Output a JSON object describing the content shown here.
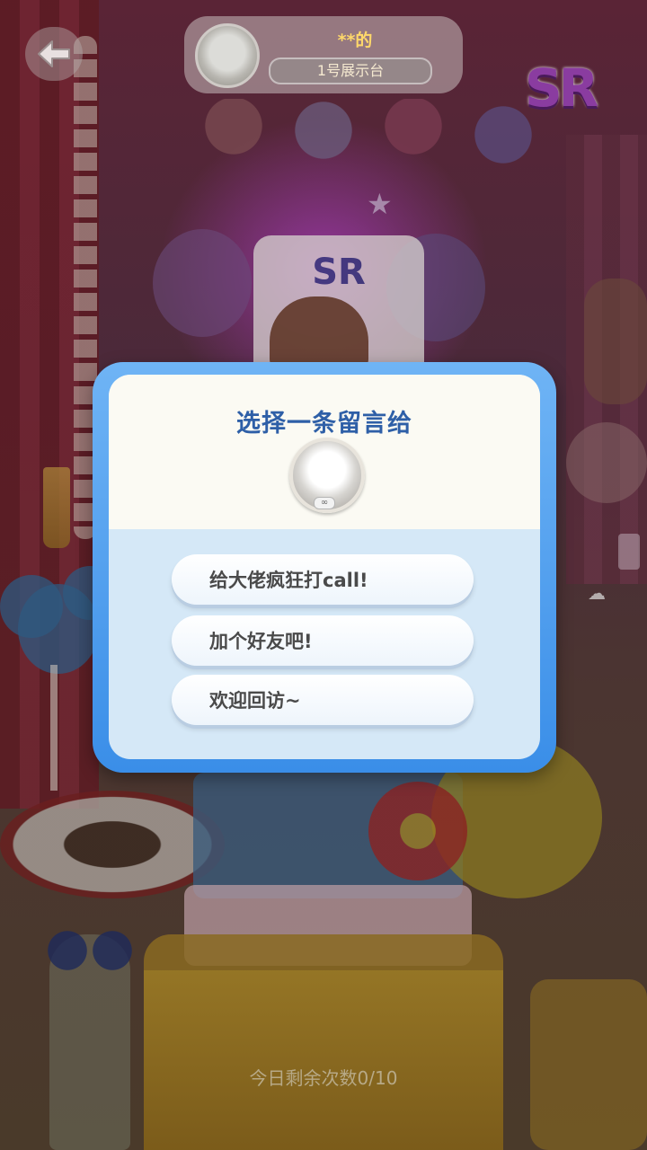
{
  "header": {
    "owner_name": "**的",
    "stage_label": "1号展示台",
    "rarity_badge": "SR",
    "back_icon": "back-arrow-icon"
  },
  "scene": {
    "ticket_label": "SR"
  },
  "dialog": {
    "title": "选择一条留言给",
    "avatar_tag": "∞",
    "options": [
      {
        "label": "给大佬疯狂打call!"
      },
      {
        "label": "加个好友吧!"
      },
      {
        "label": "欢迎回访~"
      }
    ]
  },
  "footer": {
    "daily_remaining": "今日剩余次数0/10"
  },
  "colors": {
    "dialog_frame": "#3a8ee8",
    "dialog_title": "#2e5fa7",
    "owner_name": "#ffd86a",
    "footer_text": "#b7a987"
  }
}
